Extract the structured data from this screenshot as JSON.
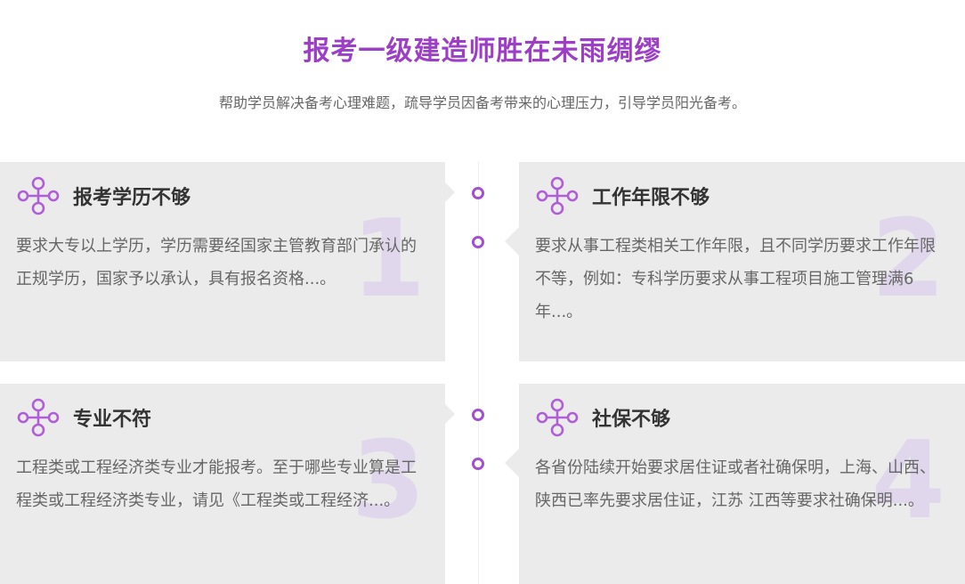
{
  "header": {
    "title": "报考一级建造师胜在未雨绸缪",
    "subtitle": "帮助学员解决备考心理难题，疏导学员因备考带来的心理压力，引导学员阳光备考。"
  },
  "colors": {
    "accent": "#9d3fc6",
    "icon": "#b05ed8",
    "card_bg": "#ebebeb",
    "number": "#e1d7ec"
  },
  "cards": [
    {
      "icon": "network-nodes-icon",
      "title": "报考学历不够",
      "text": "要求大专以上学历，学历需要经国家主管教育部门承认的正规学历，国家予以承认，具有报名资格...。",
      "number": "1"
    },
    {
      "icon": "network-nodes-icon",
      "title": "工作年限不够",
      "text": "要求从事工程类相关工作年限，且不同学历要求工作年限不等，例如：专科学历要求从事工程项目施工管理满6年...。",
      "number": "2"
    },
    {
      "icon": "network-nodes-icon",
      "title": "专业不符",
      "text": "工程类或工程经济类专业才能报考。至于哪些专业算是工程类或工程经济类专业，请见《工程类或工程经济...。",
      "number": "3"
    },
    {
      "icon": "network-nodes-icon",
      "title": "社保不够",
      "text": "各省份陆续开始要求居住证或者社确保明，上海、山西、陕西已率先要求居住证，江苏 江西等要求社确保明...。",
      "number": "4"
    }
  ]
}
